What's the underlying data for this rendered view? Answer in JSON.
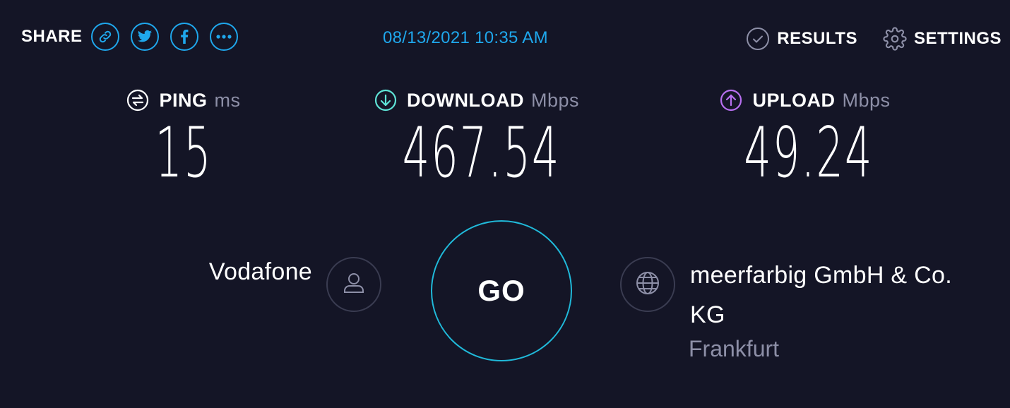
{
  "header": {
    "share_label": "SHARE",
    "share_icons": [
      "link-icon",
      "twitter-icon",
      "facebook-icon",
      "more-icon"
    ],
    "timestamp": "08/13/2021 10:35 AM",
    "results_label": "RESULTS",
    "settings_label": "SETTINGS"
  },
  "metrics": {
    "ping": {
      "label": "PING",
      "unit": "ms",
      "value": "15"
    },
    "download": {
      "label": "DOWNLOAD",
      "unit": "Mbps",
      "value": "467.54"
    },
    "upload": {
      "label": "UPLOAD",
      "unit": "Mbps",
      "value": "49.24"
    }
  },
  "connection": {
    "isp": "Vodafone",
    "go_label": "GO",
    "server_name": "meerfarbig GmbH & Co. KG",
    "server_location": "Frankfurt"
  },
  "colors": {
    "background": "#141526",
    "accent_blue": "#1fa7ec",
    "go_ring": "#20b9d9",
    "download_icon": "#5fe3d6",
    "upload_icon": "#b76ff0",
    "muted_text": "#8d8fa7"
  }
}
